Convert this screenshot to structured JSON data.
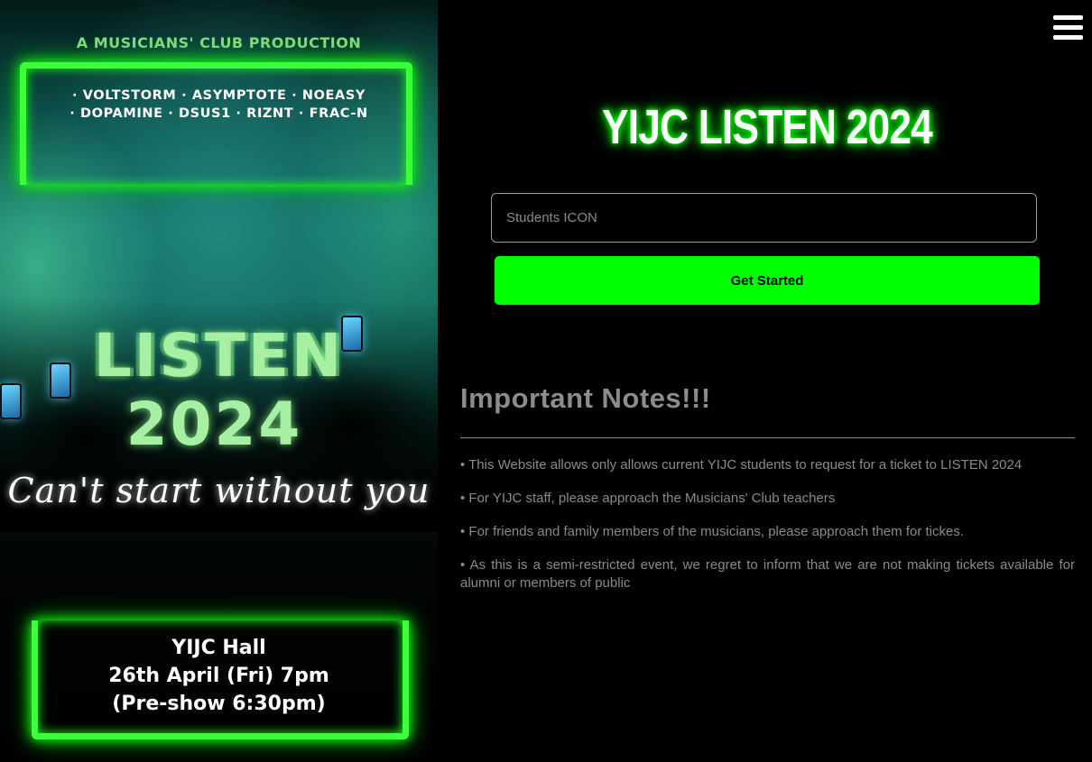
{
  "poster": {
    "credit": "A MUSICIANS' CLUB PRODUCTION",
    "lineup_line1": "· VOLTSTORM · ASYMPTOTE · NOEASY",
    "lineup_line2": "· DOPAMINE · DSUS1 · RIZNT · FRAC-N",
    "event_name": "LISTEN",
    "event_year": "2024",
    "tagline": "Can't start without you",
    "venue": "YIJC Hall",
    "date_time": "26th April (Fri) 7pm",
    "preshow": "(Pre-show 6:30pm)"
  },
  "header": {
    "menu_icon": "hamburger-menu-icon"
  },
  "main": {
    "title": "YIJC LISTEN 2024",
    "icon_input": {
      "placeholder": "Students ICON",
      "value": ""
    },
    "get_started_label": "Get Started"
  },
  "notes": {
    "title": "Important Notes!!!",
    "items": [
      "• This Website allows only allows current YIJC students to request for a ticket to LISTEN 2024",
      "• For YIJC staff, please approach the Musicians' Club teachers",
      "• For friends and family members of the musicians, please approach them for tickes.",
      "• As this is a semi-restricted event, we regret to inform that we are not making tickets available for alumni or members of public"
    ]
  },
  "colors": {
    "accent_green": "#00ff00",
    "poster_green": "#a7f0a3",
    "background": "#000000",
    "muted_text": "#8a8a8a"
  }
}
